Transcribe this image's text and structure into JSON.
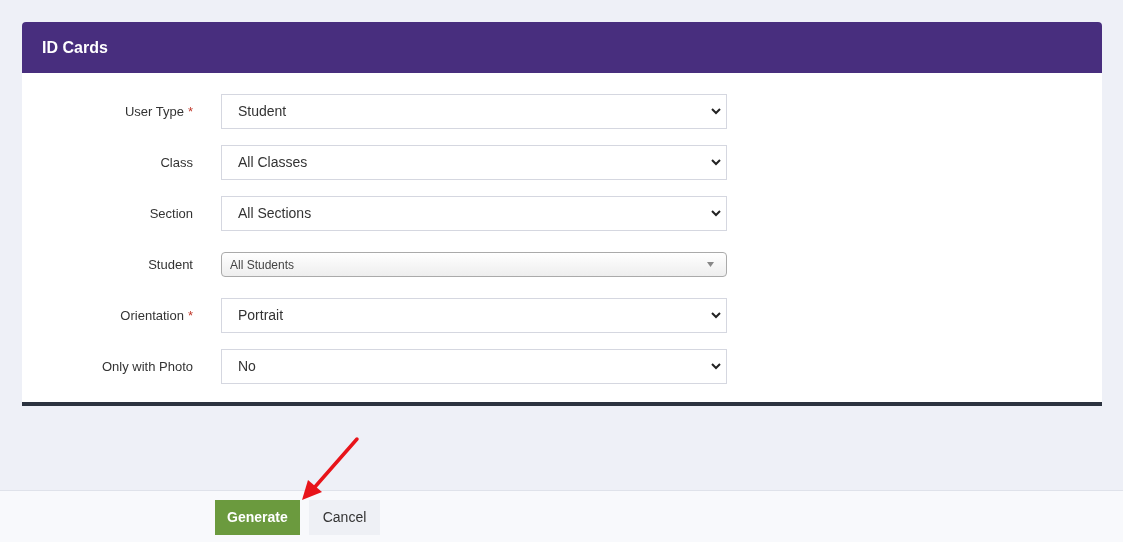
{
  "card": {
    "title": "ID Cards"
  },
  "fields": [
    {
      "label": "User Type",
      "marker": "*",
      "kind": "select",
      "value": "Student"
    },
    {
      "label": "Class",
      "kind": "select",
      "value": "All Classes"
    },
    {
      "label": "Section",
      "kind": "select",
      "value": "All Sections"
    },
    {
      "label": "Student",
      "kind": "combo",
      "value": "All Students"
    },
    {
      "label": "Orientation",
      "marker": "*",
      "kind": "select",
      "value": "Portrait"
    },
    {
      "label": "Only with Photo",
      "kind": "select",
      "value": "No"
    }
  ],
  "footer": {
    "buttons": [
      {
        "label": "Generate",
        "kind": "primary"
      },
      {
        "label": "Cancel",
        "kind": "secondary"
      }
    ]
  }
}
